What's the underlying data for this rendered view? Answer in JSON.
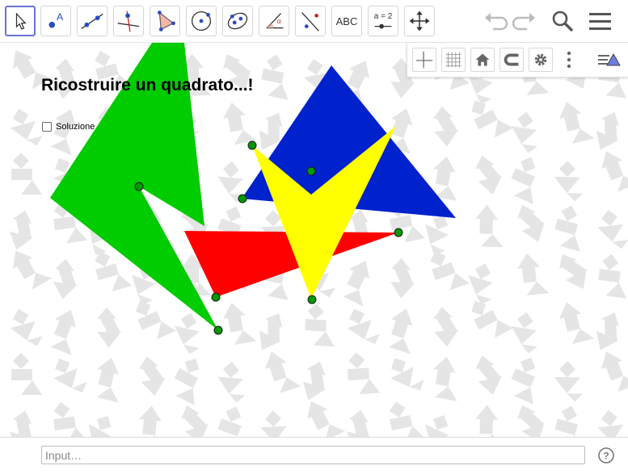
{
  "toolbar": {
    "tools": [
      {
        "name": "move-tool"
      },
      {
        "name": "point-tool",
        "label": "A"
      },
      {
        "name": "line-tool"
      },
      {
        "name": "perpendicular-line-tool"
      },
      {
        "name": "polygon-tool"
      },
      {
        "name": "circle-center-point-tool"
      },
      {
        "name": "conic-tool"
      },
      {
        "name": "angle-tool"
      },
      {
        "name": "reflect-tool"
      },
      {
        "name": "text-tool",
        "label": "ABC"
      },
      {
        "name": "slider-tool",
        "label": "a = 2"
      },
      {
        "name": "move-graphics-view-tool"
      }
    ],
    "right_icons": [
      "undo-icon",
      "redo-icon",
      "search-icon",
      "menu-icon"
    ]
  },
  "stylebar": {
    "icons": [
      "axes-icon",
      "grid-icon",
      "home-icon",
      "point-capturing-icon",
      "settings-icon",
      "more-vertical-icon",
      "style-bar-toggle-icon"
    ]
  },
  "graphics": {
    "title": "Ricostruire un quadrato...!",
    "checkbox_label": "Soluzione",
    "checkbox_checked": false,
    "colors": {
      "green": "#00cc00",
      "blue": "#0022cc",
      "red": "#ff0000",
      "yellow": "#ffff00",
      "point": "#009900",
      "background_silhouettes": "#e5e5e5"
    }
  },
  "input_bar": {
    "placeholder": "Input…",
    "help_icon": "help-icon"
  }
}
